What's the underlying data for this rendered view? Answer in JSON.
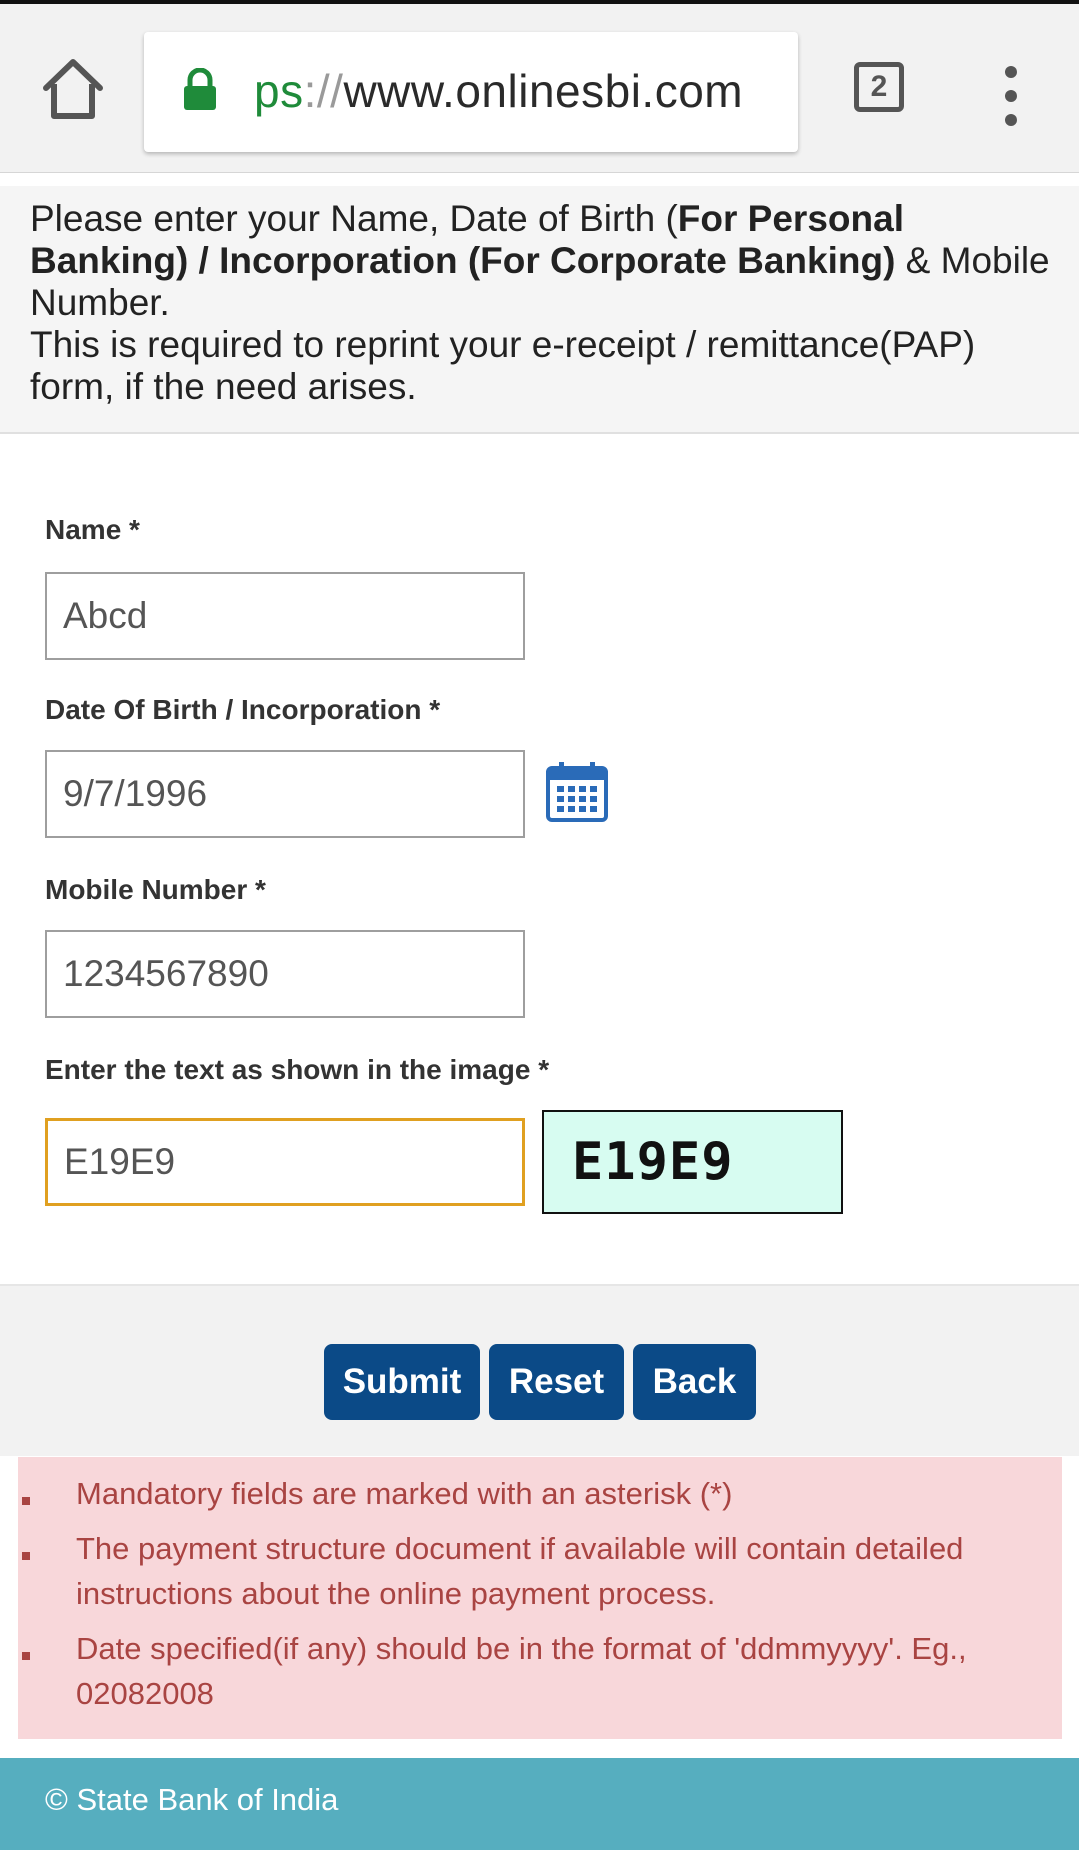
{
  "browser": {
    "url_scheme": "ps",
    "url_slashes": "://",
    "url_host": "www.onlinesbi.com",
    "tab_count": "2"
  },
  "notice": {
    "line1_plain": "Please enter your Name, Date of Birth (",
    "line1_bold": "For Personal Banking) / Incorporation (For Corporate Banking)",
    "line1_tail": " & Mobile Number.",
    "line2": "This is required to reprint your e-receipt / remittance(PAP) form, if the need arises."
  },
  "form": {
    "name_label": "Name *",
    "name_value": "Abcd",
    "dob_label": "Date Of Birth / Incorporation *",
    "dob_value": "9/7/1996",
    "mobile_label": "Mobile Number *",
    "mobile_value": "1234567890",
    "captcha_label": "Enter the text as shown in the image *",
    "captcha_value": "E19E9",
    "captcha_image_text": "E19E9"
  },
  "buttons": {
    "submit": "Submit",
    "reset": "Reset",
    "back": "Back"
  },
  "notes": [
    "Mandatory fields are marked with an asterisk (*)",
    "The payment structure document if available will contain detailed instructions about the online payment process.",
    "Date specified(if any) should be in the format of 'ddmmyyyy'. Eg., 02082008"
  ],
  "footer": {
    "text": "© State Bank of India"
  },
  "colors": {
    "button_bg": "#0b4a87",
    "notes_bg": "#f8d7da",
    "notes_text": "#a94442",
    "footer_bg": "#56aebf",
    "captcha_bg": "#d7fcf1",
    "focus_border": "#e0a020"
  },
  "icons": {
    "home": "home-icon",
    "lock": "lock-icon",
    "tabs": "tabs-icon",
    "menu": "more-vert-icon",
    "calendar": "calendar-icon"
  }
}
